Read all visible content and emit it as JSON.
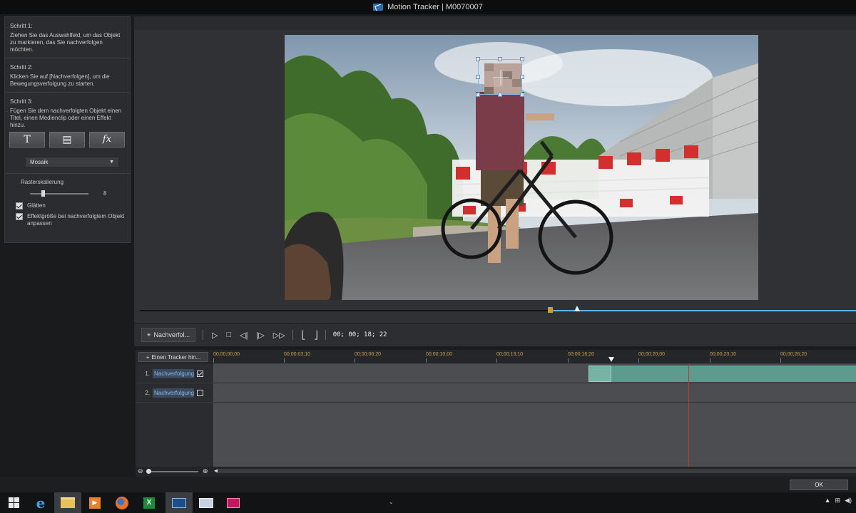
{
  "window": {
    "title": "Motion Tracker | M0070007"
  },
  "left_panel": {
    "step1": {
      "heading": "Schritt 1:",
      "text": "Ziehen Sie das Auswahlfeld, um das Objekt zu markieren, das Sie nachverfolgen möchten."
    },
    "step2": {
      "heading": "Schritt 2:",
      "text": "Klicken Sie auf [Nachverfolgen], um die Bewegungsverfolgung zu starten."
    },
    "step3": {
      "heading": "Schritt 3:",
      "text": "Fügen Sie dem nachverfolgten Objekt einen Titel, einen Medienclip oder einen Effekt hinzu."
    },
    "buttons": {
      "title": "T",
      "media": "▤",
      "effect": "fx"
    },
    "effect_select": {
      "value": "Mosaik"
    },
    "raster": {
      "label": "Rasterskalierung",
      "value": "8",
      "fraction": 0.2
    },
    "checkboxes": [
      {
        "label": "Glätten",
        "checked": true
      },
      {
        "label": "Effektgröße bei nachverfolgtem Objekt anpassen",
        "checked": true
      }
    ]
  },
  "controls": {
    "track_button": "Nachverfol...",
    "timecode": "00; 00; 18; 22"
  },
  "timeline": {
    "add_tracker_button": "Einen Tracker hin...",
    "ruler": [
      "00;00;00;00",
      "00;00;03;10",
      "00;00;06;20",
      "00;00;10;00",
      "00;00;13;10",
      "00;00;16;20",
      "00;00;20;00",
      "00;00;23;10",
      "00;00;26;20"
    ],
    "tracks": [
      {
        "num": "1.",
        "name": "Nachverfolgung",
        "checked": true
      },
      {
        "num": "2.",
        "name": "Nachverfolgung",
        "checked": false
      }
    ]
  },
  "footer": {
    "ok_button": "OK"
  },
  "taskbar": {
    "icons": [
      "windows-start-icon",
      "internet-explorer-icon",
      "file-explorer-icon",
      "media-player-icon",
      "firefox-icon",
      "excel-icon",
      "powerdirector-icon"
    ]
  },
  "colors": {
    "accent_blue": "#5fb6e5",
    "clip_teal": "#5f9a8e",
    "playhead_red": "#c0392b",
    "timecode_orange": "#c9a24a"
  }
}
